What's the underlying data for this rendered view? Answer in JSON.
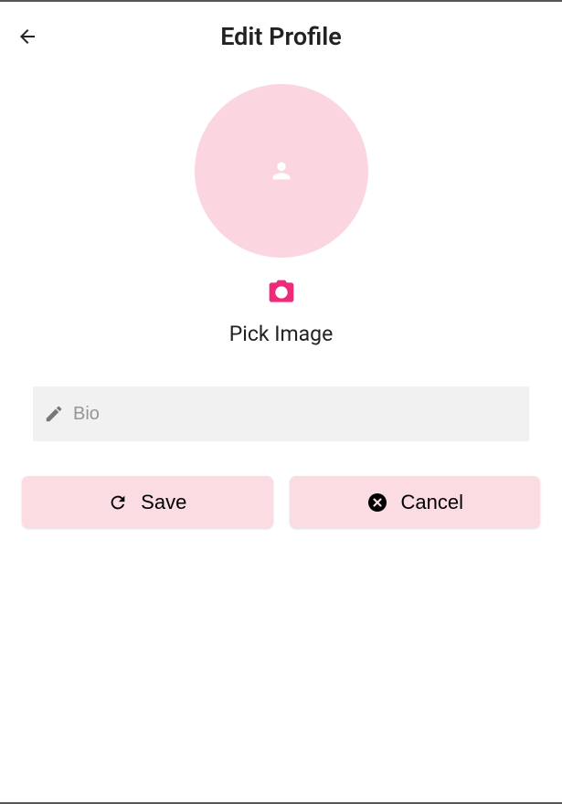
{
  "header": {
    "title": "Edit Profile"
  },
  "avatar": {
    "pick_label": "Pick Image"
  },
  "form": {
    "bio_placeholder": "Bio",
    "bio_value": ""
  },
  "buttons": {
    "save_label": "Save",
    "cancel_label": "Cancel"
  },
  "colors": {
    "accent_light": "#fbdce3",
    "accent": "#ee2a7b",
    "input_bg": "#f1f1f1"
  }
}
